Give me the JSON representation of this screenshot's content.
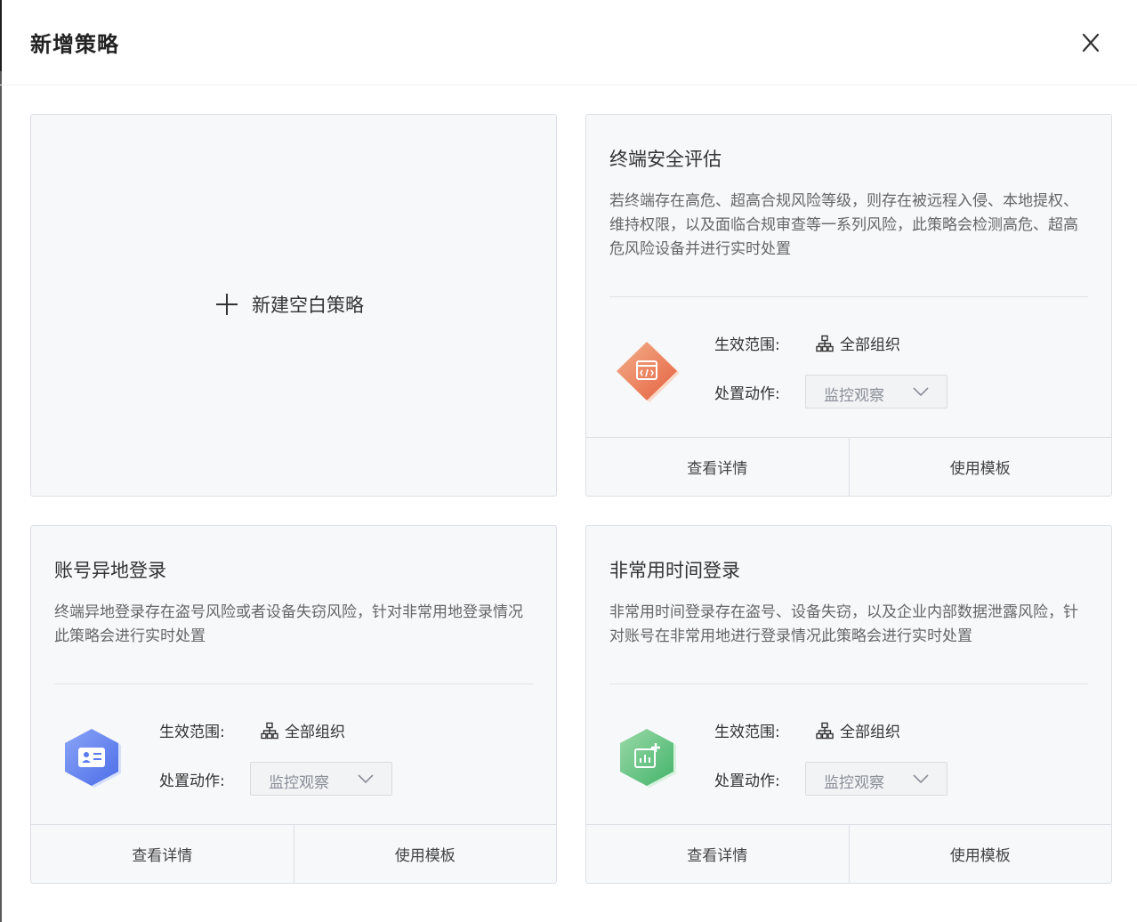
{
  "dialog": {
    "title": "新增策略",
    "close_icon": "close-icon"
  },
  "blank_card": {
    "label": "新建空白策略",
    "icon": "plus-icon"
  },
  "labels": {
    "scope": "生效范围:",
    "action": "处置动作:"
  },
  "cards": [
    {
      "title": "终端安全评估",
      "description": "若终端存在高危、超高合规风险等级，则存在被远程入侵、本地提权、维持权限，以及面临合规审查等一系列风险，此策略会检测高危、超高危风险设备并进行实时处置",
      "icon": "code-window-hex-icon",
      "icon_color": "#ef7a55",
      "scope": "全部组织",
      "action": "监控观察",
      "details_label": "查看详情",
      "use_label": "使用模板"
    },
    {
      "title": "账号异地登录",
      "description": "终端异地登录存在盗号风险或者设备失窃风险，针对非常用地登录情况此策略会进行实时处置",
      "icon": "id-card-hex-icon",
      "icon_color": "#5b7cf0",
      "scope": "全部组织",
      "action": "监控观察",
      "details_label": "查看详情",
      "use_label": "使用模板"
    },
    {
      "title": "非常用时间登录",
      "description": "非常用时间登录存在盗号、设备失窃，以及企业内部数据泄露风险，针对账号在非常用地进行登录情况此策略会进行实时处置",
      "icon": "chart-add-hex-icon",
      "icon_color": "#5cc27a",
      "scope": "全部组织",
      "action": "监控观察",
      "details_label": "查看详情",
      "use_label": "使用模板"
    }
  ]
}
